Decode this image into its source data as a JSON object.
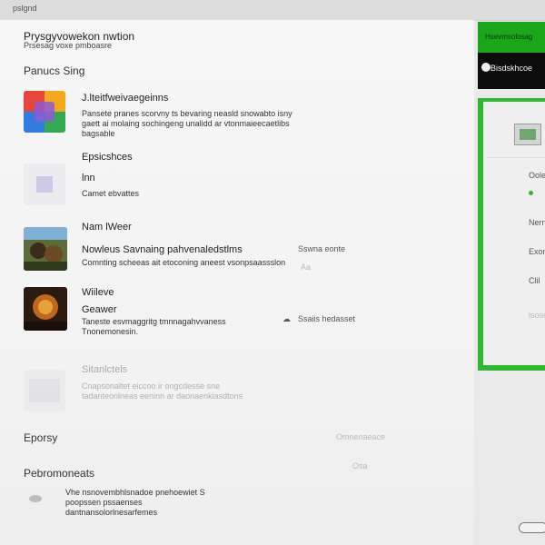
{
  "topbar": {
    "title": "pslgnd"
  },
  "header": {
    "title": "Prysgyvowekon nwtion",
    "subtitle": "Prsesag voxe pmboasre"
  },
  "sections": {
    "first": "Panucs Sing",
    "eponymous": "Eporsy",
    "peripherals": "Pebromoneats"
  },
  "items": [
    {
      "title": "J.lteitfweivaegeinns",
      "description": "Pansete pranes scorvny ts bevaring neasld snowabto isny gaett ai molaing sochingeng unalidd ar vtonmaieecaetlibs bagsable",
      "meta_text": "",
      "meta_label": ""
    },
    {
      "title": "Epsicshces",
      "title2": "lnn",
      "description": "Camet ebvattes",
      "meta_text": "",
      "meta_label": ""
    },
    {
      "title": "Nam lWeer",
      "title2": "Nowleus Savnaing pahvenaledstlms",
      "description": "Comnting scheeas ait etoconing aneest vsonpsaassslon",
      "meta_text": "Sswna eonte",
      "meta_label": "Aa"
    },
    {
      "title": "Wiileve",
      "title2": "Geawer",
      "description": "Taneste esvmaggritg tmnnagahvvaness Tnonemonesin.",
      "meta_text": "Ssaiis hedasset",
      "meta_label": ""
    },
    {
      "title": "Sitanlctels",
      "description": "Cnapsonaltet eiccoo ir ongcdesse sne tadanteonlneas eeninn ar daonaenkiasdtons",
      "meta_text": "",
      "meta_label": ""
    }
  ],
  "side_metas": {
    "eporsy": "Omnenaeace",
    "peripherals": "Osa"
  },
  "footer": {
    "text": "Vhe nsnovembhlsnadoe pnehoewiet S poopssen pssaenses dantnansolorlnesarfemes"
  },
  "right_panel": {
    "top_label": "Hsevmsolosag",
    "button_label": "Bisdskhcoe",
    "items": [
      "Oolei",
      "Nern",
      "Exon",
      "Clil",
      "lsose"
    ]
  },
  "colors": {
    "accent_green": "#2fb82f",
    "panel_black": "#0c0c0c"
  }
}
